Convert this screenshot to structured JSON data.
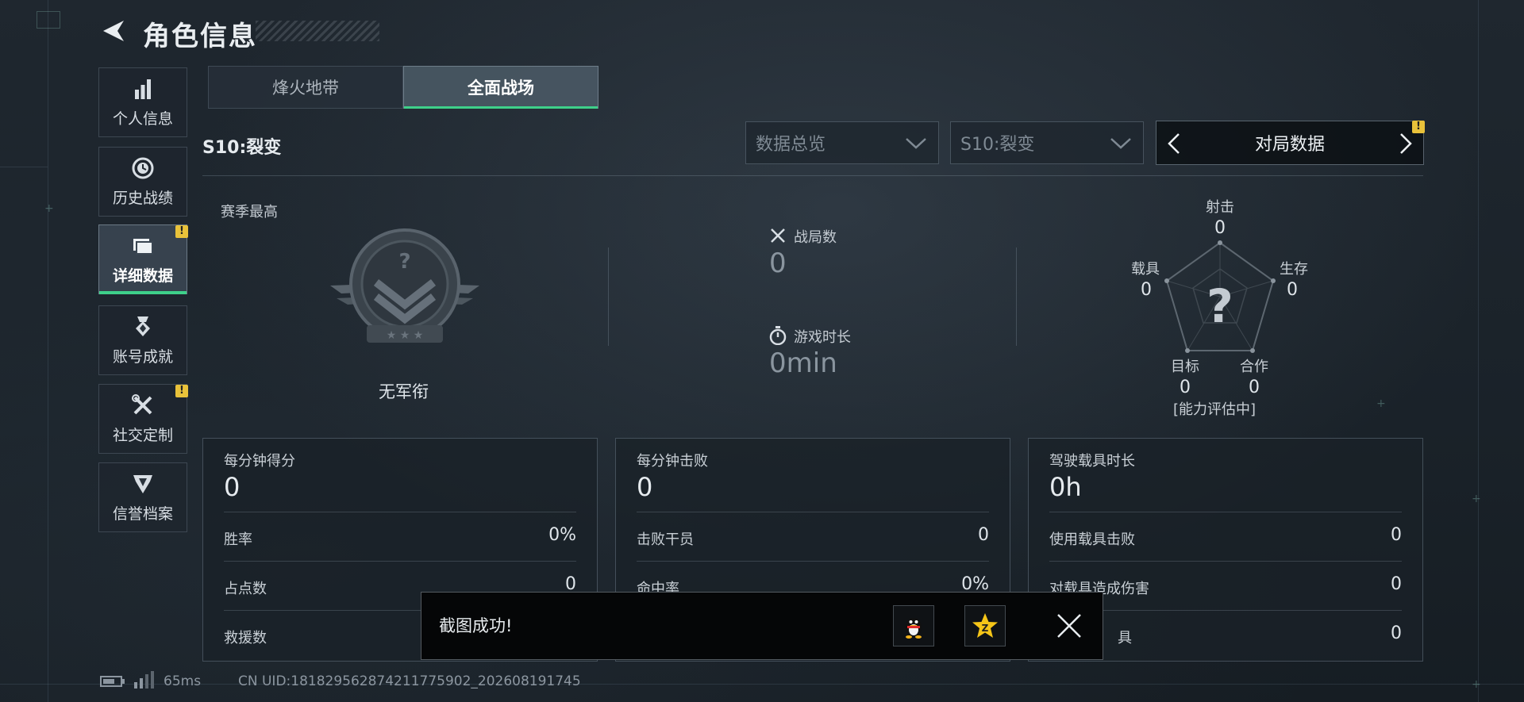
{
  "header": {
    "title": "角色信息"
  },
  "sidebar": {
    "items": [
      {
        "label": "个人信息",
        "icon": "bar-chart-icon"
      },
      {
        "label": "历史战绩",
        "icon": "history-clock-icon"
      },
      {
        "label": "详细数据",
        "icon": "folder-icon",
        "active": true,
        "badge": "!"
      },
      {
        "label": "账号成就",
        "icon": "medal-icon"
      },
      {
        "label": "社交定制",
        "icon": "tools-icon",
        "badge": "!"
      },
      {
        "label": "信誉档案",
        "icon": "shield-emblem-icon"
      }
    ]
  },
  "tabs": [
    {
      "label": "烽火地带",
      "active": false
    },
    {
      "label": "全面战场",
      "active": true
    }
  ],
  "season_label": "S10:裂变",
  "filters": {
    "data_type": "数据总览",
    "season": "S10:裂变",
    "pager_label": "对局数据",
    "pager_badge": "!"
  },
  "rank": {
    "heading": "赛季最高",
    "rank_name": "无军衔",
    "emblem_glyph": "?"
  },
  "match_stats": {
    "battles_label": "战局数",
    "battles_value": "0",
    "playtime_label": "游戏时长",
    "playtime_value": "0min"
  },
  "radar": {
    "center_glyph": "?",
    "axes": [
      {
        "label": "射击",
        "value": "0"
      },
      {
        "label": "生存",
        "value": "0"
      },
      {
        "label": "合作",
        "value": "0"
      },
      {
        "label": "目标",
        "value": "0"
      },
      {
        "label": "载具",
        "value": "0"
      }
    ],
    "status": "[能力评估中]"
  },
  "cards": [
    {
      "title": "每分钟得分",
      "value": "0",
      "rows": [
        {
          "k": "胜率",
          "v": "0%"
        },
        {
          "k": "占点数",
          "v": "0"
        },
        {
          "k": "救援数",
          "v": ""
        }
      ]
    },
    {
      "title": "每分钟击败",
      "value": "0",
      "rows": [
        {
          "k": "击败干员",
          "v": "0"
        },
        {
          "k": "命中率",
          "v": "0%"
        },
        {
          "k": "",
          "v": ""
        }
      ]
    },
    {
      "title": "驾驶载具时长",
      "value": "0h",
      "rows": [
        {
          "k": "使用载具击败",
          "v": "0"
        },
        {
          "k": "对载具造成伤害",
          "v": "0"
        },
        {
          "k": "具",
          "v": "0"
        }
      ]
    }
  ],
  "toast": {
    "message": "截图成功!",
    "share_qq": "qq-penguin-icon",
    "share_qzone": "qzone-star-icon"
  },
  "footer": {
    "ping": "65ms",
    "uid": "CN UID:18182956287421177​5902_202608191745"
  },
  "colors": {
    "accent": "#3ed08a",
    "badge": "#e9c23a",
    "bg": "#1c242b"
  }
}
